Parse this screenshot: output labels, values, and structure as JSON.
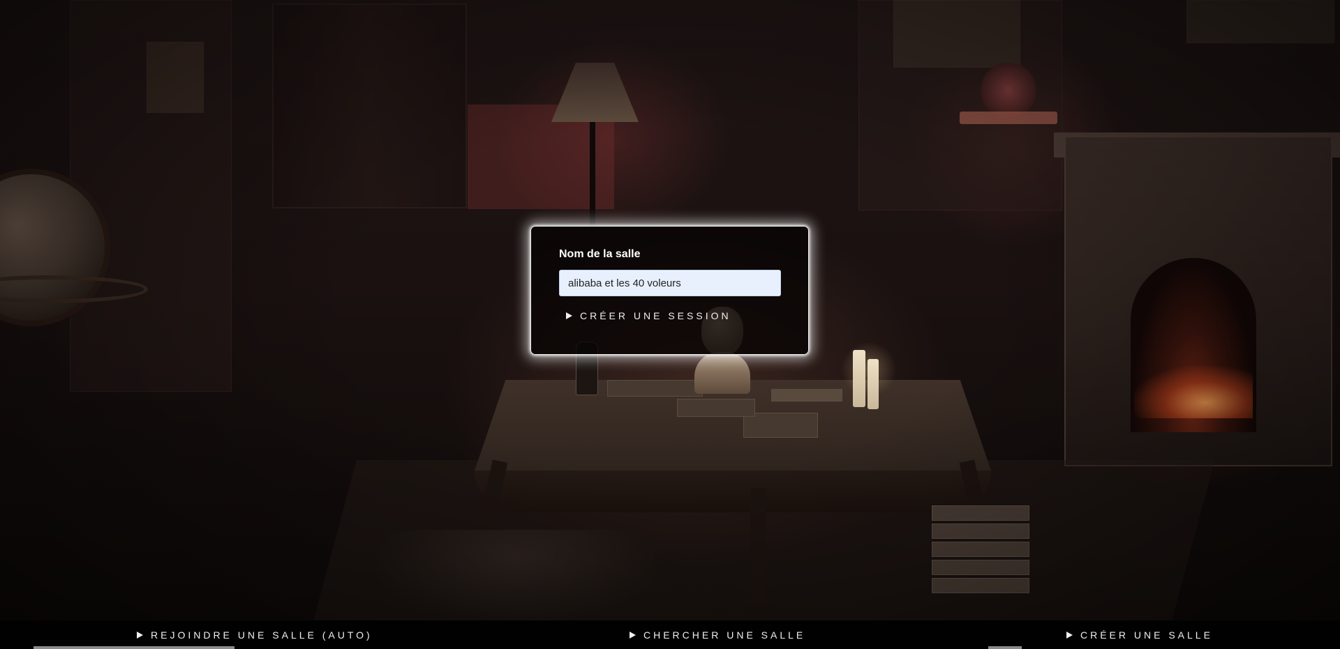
{
  "modal": {
    "field_label": "Nom de la salle",
    "room_name_value": "alibaba et les 40 voleurs",
    "create_session_label": "CRÉER UNE SESSION"
  },
  "bottom_nav": {
    "join_auto_label": "REJOINDRE UNE SALLE (AUTO)",
    "search_label": "CHERCHER UNE SALLE",
    "create_label": "CRÉER UNE SALLE"
  },
  "icons": {
    "nav_icon": "play-triangle-icon"
  },
  "colors": {
    "modal_border": "#f2f2f2",
    "input_background": "#e8f0fe",
    "text": "#f0f0f0"
  }
}
